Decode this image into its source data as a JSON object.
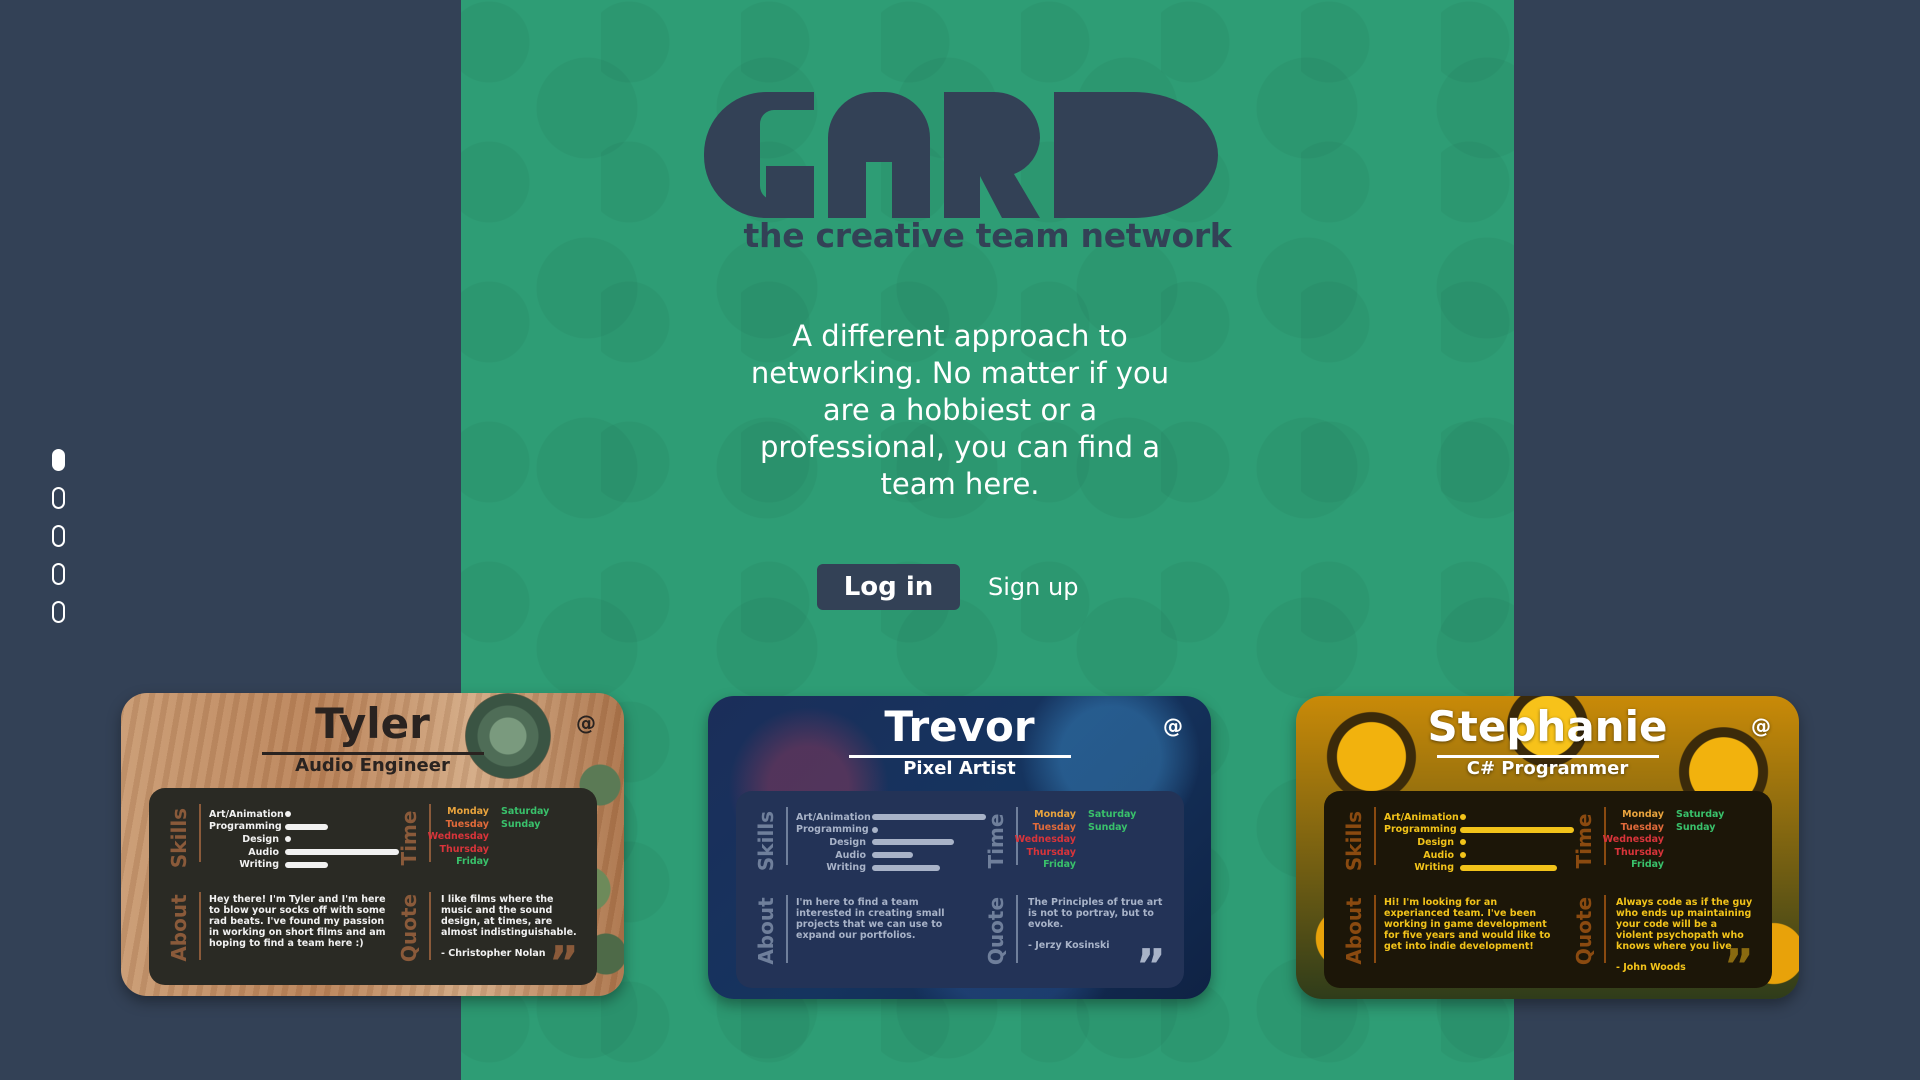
{
  "logo": {
    "text": "CARD"
  },
  "tagline": "the creative team network",
  "intro": "A different approach to networking. No matter if you are a hobbiest or a professional, you can find a team here.",
  "buttons": {
    "login": "Log in",
    "signup": "Sign up"
  },
  "pagination": {
    "total": 5,
    "active_index": 0
  },
  "colors": {
    "background": "#334156",
    "hero": "#2e9d75",
    "text_dark": "#334156",
    "day_monday": "#e8a33d",
    "day_tuesday": "#e06a3a",
    "day_wednesday": "#d8343a",
    "day_thursday": "#d8343a",
    "day_friday": "#39c16b",
    "day_saturday": "#39c16b",
    "day_sunday": "#39c16b"
  },
  "labels": {
    "skills": "Skills",
    "time": "Time",
    "about": "About",
    "quote": "Quote",
    "at": "@",
    "quote_mark": "”"
  },
  "cards": [
    {
      "name": "Tyler",
      "role": "Audio Engineer",
      "skills": [
        {
          "name": "Art/Animation",
          "level": 0.0
        },
        {
          "name": "Programming",
          "level": 0.38
        },
        {
          "name": "Design",
          "level": 0.0
        },
        {
          "name": "Audio",
          "level": 1.0
        },
        {
          "name": "Writing",
          "level": 0.38
        }
      ],
      "days_left": [
        "Monday",
        "Tuesday",
        "Wednesday",
        "Thursday",
        "Friday"
      ],
      "days_right": [
        "Saturday",
        "Sunday"
      ],
      "about": "Hey there! I'm Tyler and I'm here to blow your socks off with some rad beats. I've found my passion in working on short films and am hoping to find a team here :)",
      "quote": "I like films where the music and the sound design, at times, are almost indistinguishable.",
      "quote_author": "- Christopher Nolan"
    },
    {
      "name": "Trevor",
      "role": "Pixel Artist",
      "skills": [
        {
          "name": "Art/Animation",
          "level": 1.0
        },
        {
          "name": "Programming",
          "level": 0.0
        },
        {
          "name": "Design",
          "level": 0.72
        },
        {
          "name": "Audio",
          "level": 0.36
        },
        {
          "name": "Writing",
          "level": 0.6
        }
      ],
      "days_left": [
        "Monday",
        "Tuesday",
        "Wednesday",
        "Thursday",
        "Friday"
      ],
      "days_right": [
        "Saturday",
        "Sunday"
      ],
      "about": "I'm here to find a team interested in creating small projects that we can use to expand our portfolios.",
      "quote": "The Principles of true art is not to portray, but to evoke.",
      "quote_author": "- Jerzy Kosinski"
    },
    {
      "name": "Stephanie",
      "role": "C# Programmer",
      "skills": [
        {
          "name": "Art/Animation",
          "level": 0.0
        },
        {
          "name": "Programming",
          "level": 1.0
        },
        {
          "name": "Design",
          "level": 0.0
        },
        {
          "name": "Audio",
          "level": 0.0
        },
        {
          "name": "Writing",
          "level": 0.85
        }
      ],
      "days_left": [
        "Monday",
        "Tuesday",
        "Wednesday",
        "Thursday",
        "Friday"
      ],
      "days_right": [
        "Saturday",
        "Sunday"
      ],
      "about": "Hi! I'm looking for an experianced team. I've been working in game development for five years and would like to get into indie development!",
      "quote": "Always code as if the guy who ends up maintaining your code will be a violent psychopath who knows where you live",
      "quote_author": "- John Woods"
    }
  ]
}
